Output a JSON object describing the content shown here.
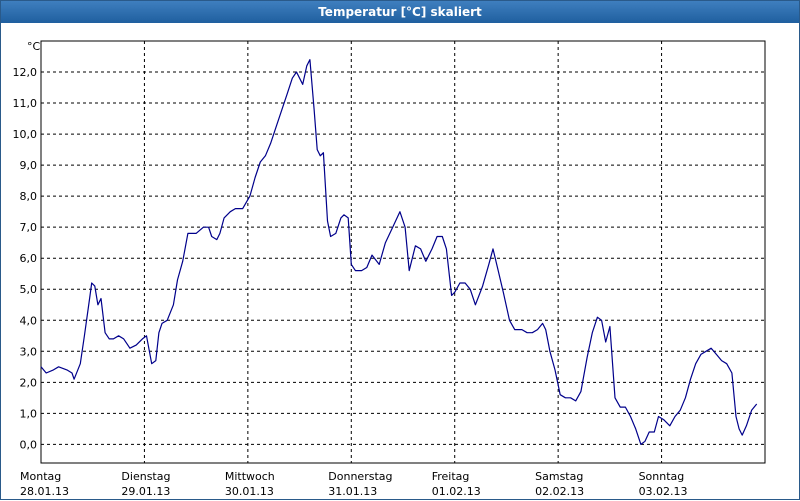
{
  "window": {
    "title": "Temperatur [°C] skaliert"
  },
  "colors": {
    "line": "#00008b",
    "grid": "#000000",
    "title_bar": "#2b6ca6"
  },
  "chart_data": {
    "type": "line",
    "title": "Temperatur [°C] skaliert",
    "ylabel": "°C",
    "xlabel": "",
    "ylim": [
      -0.6,
      13.0
    ],
    "grid": true,
    "grid_style": "dashed",
    "y_ticks": [
      "12,0",
      "11,0",
      "10,0",
      "9,0",
      "8,0",
      "7,0",
      "6,0",
      "5,0",
      "4,0",
      "3,0",
      "2,0",
      "1,0",
      "0,0"
    ],
    "x_ticks": [
      {
        "day": "Montag",
        "date": "28.01.13"
      },
      {
        "day": "Dienstag",
        "date": "29.01.13"
      },
      {
        "day": "Mittwoch",
        "date": "30.01.13"
      },
      {
        "day": "Donnerstag",
        "date": "31.01.13"
      },
      {
        "day": "Freitag",
        "date": "01.02.13"
      },
      {
        "day": "Samstag",
        "date": "02.02.13"
      },
      {
        "day": "Sonntag",
        "date": "03.02.13"
      }
    ],
    "x_unit": "days since Montag 28.01.13 00:00",
    "xlim": [
      0,
      7.0
    ],
    "series": [
      {
        "color": "#00008b",
        "points": [
          [
            0.0,
            2.5
          ],
          [
            0.05,
            2.3
          ],
          [
            0.12,
            2.4
          ],
          [
            0.17,
            2.5
          ],
          [
            0.25,
            2.4
          ],
          [
            0.3,
            2.3
          ],
          [
            0.32,
            2.1
          ],
          [
            0.38,
            2.6
          ],
          [
            0.42,
            3.5
          ],
          [
            0.47,
            4.7
          ],
          [
            0.49,
            5.2
          ],
          [
            0.52,
            5.1
          ],
          [
            0.55,
            4.5
          ],
          [
            0.58,
            4.7
          ],
          [
            0.62,
            3.6
          ],
          [
            0.66,
            3.4
          ],
          [
            0.7,
            3.4
          ],
          [
            0.75,
            3.5
          ],
          [
            0.8,
            3.4
          ],
          [
            0.86,
            3.1
          ],
          [
            0.92,
            3.2
          ],
          [
            0.98,
            3.4
          ],
          [
            1.02,
            3.5
          ],
          [
            1.07,
            2.6
          ],
          [
            1.11,
            2.7
          ],
          [
            1.14,
            3.6
          ],
          [
            1.17,
            3.9
          ],
          [
            1.22,
            4.0
          ],
          [
            1.28,
            4.5
          ],
          [
            1.32,
            5.3
          ],
          [
            1.37,
            5.9
          ],
          [
            1.42,
            6.8
          ],
          [
            1.5,
            6.8
          ],
          [
            1.57,
            7.0
          ],
          [
            1.62,
            7.0
          ],
          [
            1.65,
            6.7
          ],
          [
            1.7,
            6.6
          ],
          [
            1.73,
            6.8
          ],
          [
            1.77,
            7.3
          ],
          [
            1.83,
            7.5
          ],
          [
            1.88,
            7.6
          ],
          [
            1.95,
            7.6
          ],
          [
            2.02,
            8.0
          ],
          [
            2.07,
            8.6
          ],
          [
            2.12,
            9.1
          ],
          [
            2.17,
            9.3
          ],
          [
            2.22,
            9.7
          ],
          [
            2.28,
            10.3
          ],
          [
            2.33,
            10.8
          ],
          [
            2.38,
            11.3
          ],
          [
            2.43,
            11.8
          ],
          [
            2.47,
            12.0
          ],
          [
            2.5,
            11.8
          ],
          [
            2.53,
            11.6
          ],
          [
            2.57,
            12.2
          ],
          [
            2.6,
            12.4
          ],
          [
            2.64,
            10.8
          ],
          [
            2.67,
            9.5
          ],
          [
            2.7,
            9.3
          ],
          [
            2.73,
            9.4
          ],
          [
            2.77,
            7.2
          ],
          [
            2.8,
            6.7
          ],
          [
            2.85,
            6.8
          ],
          [
            2.9,
            7.3
          ],
          [
            2.93,
            7.4
          ],
          [
            2.97,
            7.3
          ],
          [
            3.0,
            5.8
          ],
          [
            3.04,
            5.6
          ],
          [
            3.1,
            5.6
          ],
          [
            3.15,
            5.7
          ],
          [
            3.2,
            6.1
          ],
          [
            3.27,
            5.8
          ],
          [
            3.33,
            6.5
          ],
          [
            3.4,
            7.0
          ],
          [
            3.47,
            7.5
          ],
          [
            3.52,
            7.0
          ],
          [
            3.56,
            5.6
          ],
          [
            3.62,
            6.4
          ],
          [
            3.67,
            6.3
          ],
          [
            3.72,
            5.9
          ],
          [
            3.78,
            6.3
          ],
          [
            3.83,
            6.7
          ],
          [
            3.88,
            6.7
          ],
          [
            3.92,
            6.3
          ],
          [
            3.97,
            4.8
          ],
          [
            4.0,
            4.9
          ],
          [
            4.05,
            5.2
          ],
          [
            4.1,
            5.2
          ],
          [
            4.15,
            5.0
          ],
          [
            4.2,
            4.5
          ],
          [
            4.27,
            5.1
          ],
          [
            4.33,
            5.8
          ],
          [
            4.37,
            6.3
          ],
          [
            4.42,
            5.6
          ],
          [
            4.47,
            4.9
          ],
          [
            4.53,
            4.0
          ],
          [
            4.58,
            3.7
          ],
          [
            4.65,
            3.7
          ],
          [
            4.7,
            3.6
          ],
          [
            4.75,
            3.6
          ],
          [
            4.8,
            3.7
          ],
          [
            4.85,
            3.9
          ],
          [
            4.88,
            3.7
          ],
          [
            4.92,
            3.0
          ],
          [
            4.97,
            2.4
          ],
          [
            5.02,
            1.6
          ],
          [
            5.07,
            1.5
          ],
          [
            5.12,
            1.5
          ],
          [
            5.17,
            1.4
          ],
          [
            5.22,
            1.7
          ],
          [
            5.28,
            2.8
          ],
          [
            5.33,
            3.6
          ],
          [
            5.38,
            4.1
          ],
          [
            5.42,
            4.0
          ],
          [
            5.46,
            3.3
          ],
          [
            5.5,
            3.8
          ],
          [
            5.55,
            1.5
          ],
          [
            5.6,
            1.2
          ],
          [
            5.65,
            1.2
          ],
          [
            5.7,
            0.9
          ],
          [
            5.75,
            0.5
          ],
          [
            5.8,
            0.0
          ],
          [
            5.84,
            0.1
          ],
          [
            5.88,
            0.4
          ],
          [
            5.93,
            0.4
          ],
          [
            5.97,
            0.9
          ],
          [
            6.02,
            0.8
          ],
          [
            6.08,
            0.6
          ],
          [
            6.13,
            0.9
          ],
          [
            6.18,
            1.1
          ],
          [
            6.23,
            1.5
          ],
          [
            6.28,
            2.1
          ],
          [
            6.33,
            2.6
          ],
          [
            6.38,
            2.9
          ],
          [
            6.43,
            3.0
          ],
          [
            6.48,
            3.1
          ],
          [
            6.53,
            2.9
          ],
          [
            6.58,
            2.7
          ],
          [
            6.63,
            2.6
          ],
          [
            6.68,
            2.3
          ],
          [
            6.72,
            0.9
          ],
          [
            6.75,
            0.5
          ],
          [
            6.78,
            0.3
          ],
          [
            6.82,
            0.6
          ],
          [
            6.87,
            1.1
          ],
          [
            6.92,
            1.3
          ]
        ]
      }
    ]
  }
}
